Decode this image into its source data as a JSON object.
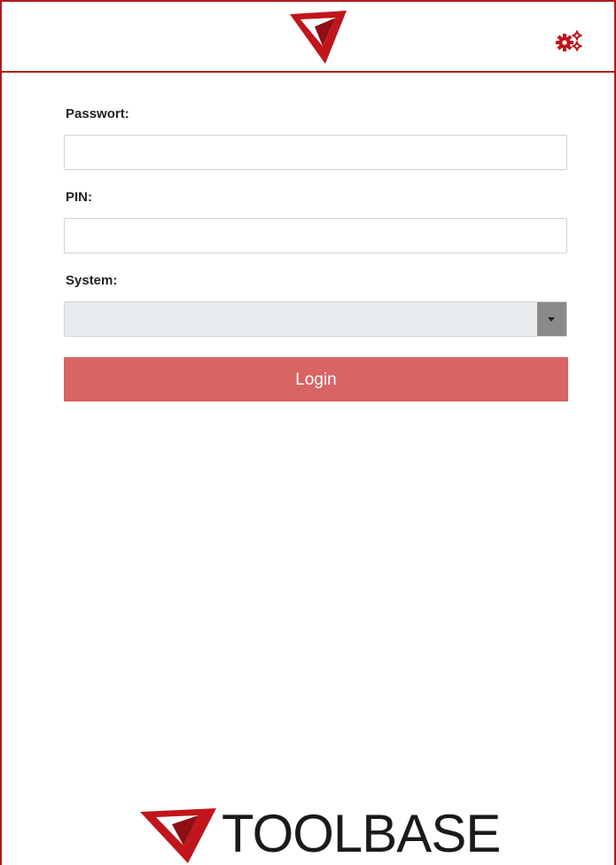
{
  "header": {
    "logo_icon": "toolbase-triangle-logo",
    "settings_icon": "gears-icon"
  },
  "form": {
    "password_label": "Passwort:",
    "password_value": "",
    "pin_label": "PIN:",
    "pin_value": "",
    "system_label": "System:",
    "system_value": "",
    "login_label": "Login"
  },
  "footer": {
    "brand": "TOOLBASE"
  },
  "colors": {
    "brand_red": "#b31b1b",
    "login_button": "#d86464",
    "select_background": "#e9ecef",
    "dropdown_arrow_bg": "#8a8a8a"
  }
}
